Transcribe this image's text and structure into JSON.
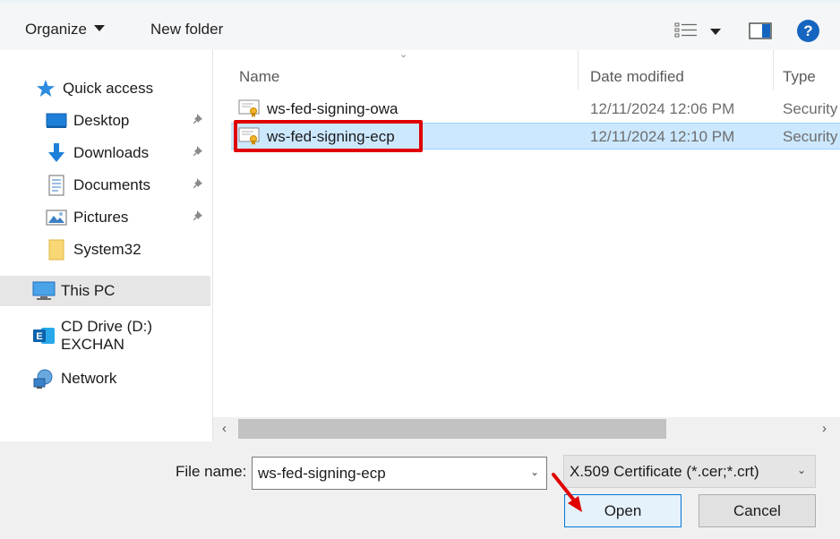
{
  "toolbar": {
    "organize_label": "Organize",
    "new_folder_label": "New folder",
    "help_glyph": "?"
  },
  "nav": {
    "items": [
      {
        "label": "Quick access",
        "icon": "star-icon"
      },
      {
        "label": "Desktop",
        "icon": "desktop-icon",
        "pinned": true
      },
      {
        "label": "Downloads",
        "icon": "download-icon",
        "pinned": true
      },
      {
        "label": "Documents",
        "icon": "documents-icon",
        "pinned": true
      },
      {
        "label": "Pictures",
        "icon": "pictures-icon",
        "pinned": true
      },
      {
        "label": "System32",
        "icon": "folder-icon"
      },
      {
        "label": "This PC",
        "icon": "pc-icon",
        "selected": true
      },
      {
        "label": "CD Drive (D:) EXCHAN",
        "icon": "exchange-drive-icon"
      },
      {
        "label": "Network",
        "icon": "network-icon"
      }
    ]
  },
  "columns": {
    "name": "Name",
    "date": "Date modified",
    "type": "Type"
  },
  "files": [
    {
      "name": "ws-fed-signing-owa",
      "date": "12/11/2024 12:06 PM",
      "type": "Security"
    },
    {
      "name": "ws-fed-signing-ecp",
      "date": "12/11/2024 12:10 PM",
      "type": "Security",
      "selected": true
    }
  ],
  "bottom": {
    "file_name_label": "File name:",
    "file_name_value": "ws-fed-signing-ecp",
    "filter_value": "X.509 Certificate (*.cer;*.crt)",
    "open_label": "Open",
    "cancel_label": "Cancel"
  },
  "colors": {
    "selection": "#cce8ff",
    "highlight_box": "#e00000",
    "accent": "#0078d7"
  }
}
